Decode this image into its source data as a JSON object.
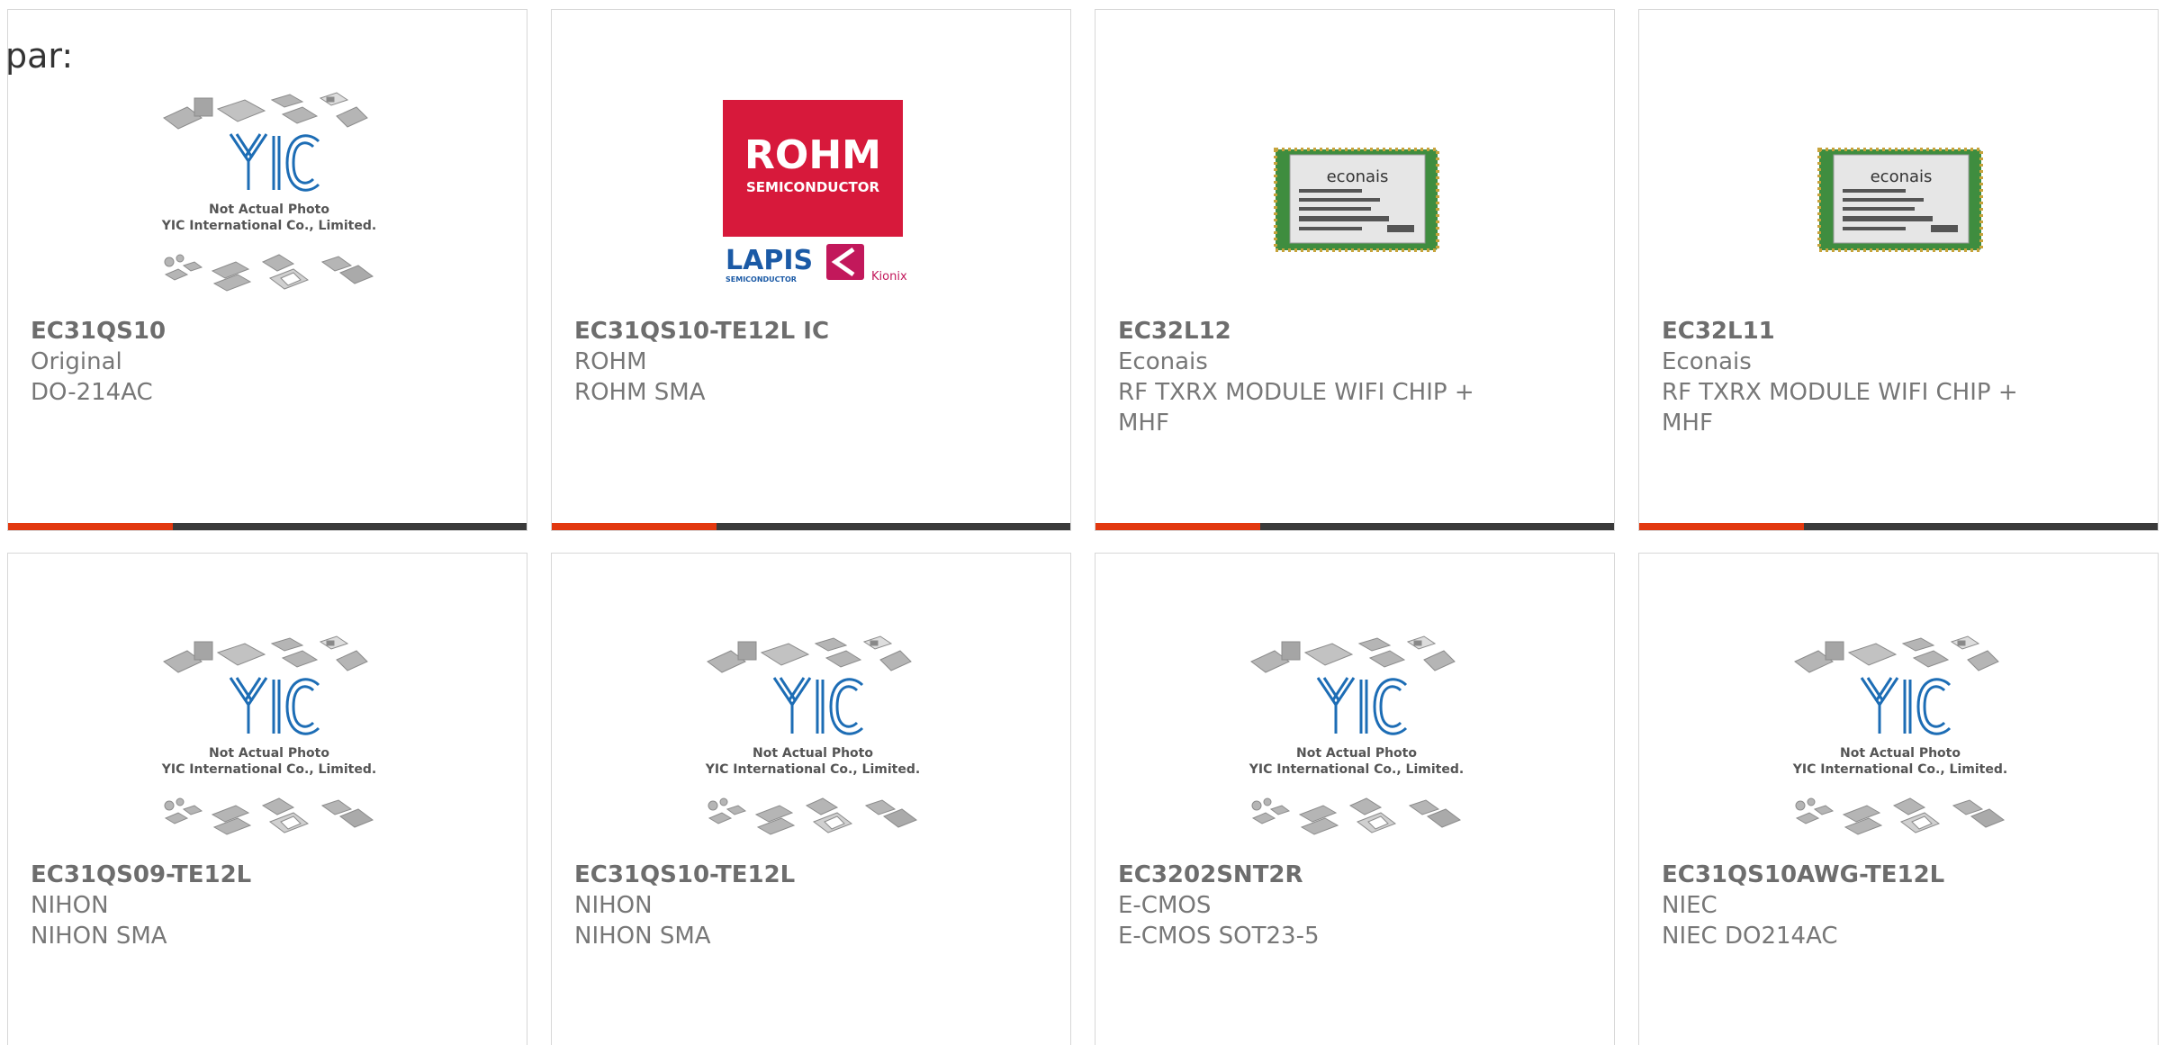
{
  "overlay_label": "par:",
  "colors": {
    "accent": "#e2380f",
    "bar_dark": "#3a3a3a",
    "text_gray": "#777777",
    "border": "#d7d7d7",
    "rohm_red": "#d7193b",
    "lapis_blue": "#1b5aa6",
    "yic_blue": "#1d6db5"
  },
  "placeholder": {
    "line1": "Not Actual Photo",
    "line2": "YIC International Co., Limited."
  },
  "rohm_logo": {
    "brand": "ROHM",
    "sub": "SEMICONDUCTOR",
    "lapis": "LAPIS",
    "lapis_sub": "SEMICONDUCTOR",
    "kionix": "Kionix"
  },
  "module_label": "econais",
  "products": [
    {
      "part": "EC31QS10",
      "maker": "Original",
      "desc": "DO-214AC",
      "image": "yic-placeholder"
    },
    {
      "part": "EC31QS10-TE12L IC",
      "maker": "ROHM",
      "desc": "ROHM SMA",
      "image": "rohm-logo"
    },
    {
      "part": "EC32L12",
      "maker": "Econais",
      "desc": "RF TXRX MODULE WIFI CHIP + MHF",
      "image": "wifi-module"
    },
    {
      "part": "EC32L11",
      "maker": "Econais",
      "desc": "RF TXRX MODULE WIFI CHIP + MHF",
      "image": "wifi-module"
    },
    {
      "part": "EC31QS09-TE12L",
      "maker": "NIHON",
      "desc": "NIHON SMA",
      "image": "yic-placeholder"
    },
    {
      "part": "EC31QS10-TE12L",
      "maker": "NIHON",
      "desc": "NIHON SMA",
      "image": "yic-placeholder"
    },
    {
      "part": "EC3202SNT2R",
      "maker": "E-CMOS",
      "desc": "E-CMOS SOT23-5",
      "image": "yic-placeholder"
    },
    {
      "part": "EC31QS10AWG-TE12L",
      "maker": "NIEC",
      "desc": "NIEC DO214AC",
      "image": "yic-placeholder"
    }
  ]
}
